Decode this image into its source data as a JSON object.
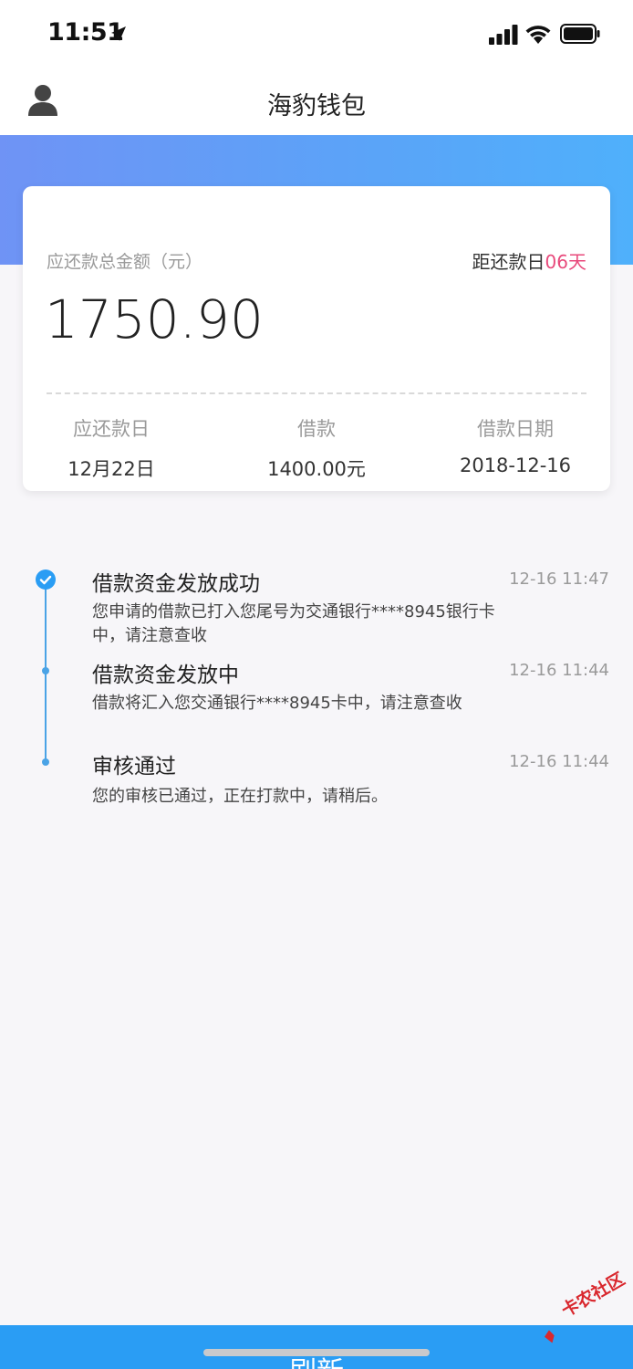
{
  "status_bar": {
    "time": "11:51",
    "icons": [
      "location-arrow-icon",
      "signal-icon",
      "wifi-icon",
      "battery-icon"
    ]
  },
  "nav": {
    "title": "海豹钱包",
    "left_icon": "profile-icon"
  },
  "summary": {
    "total_label": "应还款总金额（元）",
    "countdown_prefix": "距还款日",
    "countdown_days": "06天",
    "total_amount": "1750.90",
    "columns": [
      {
        "label": "应还款日",
        "value": "12月22日"
      },
      {
        "label": "借款",
        "value": "1400.00元"
      },
      {
        "label": "借款日期",
        "value": "2018-12-16"
      }
    ]
  },
  "timeline": [
    {
      "title": "借款资金发放成功",
      "time": "12-16 11:47",
      "desc": "您申请的借款已打入您尾号为交通银行****8945银行卡中，请注意查收"
    },
    {
      "title": "借款资金发放中",
      "time": "12-16 11:44",
      "desc": "借款将汇入您交通银行****8945卡中，请注意查收"
    },
    {
      "title": "审核通过",
      "time": "12-16 11:44",
      "desc": "您的审核已通过，正在打款中，请稍后。"
    }
  ],
  "footer": {
    "button_label": "刷新"
  },
  "watermark": {
    "text": "卡农社区"
  },
  "colors": {
    "accent": "#2a9df4",
    "timeline": "#4aa3e6",
    "highlight": "#e8497b",
    "gradient_start": "#6f93f5",
    "gradient_end": "#4fb0fb"
  }
}
